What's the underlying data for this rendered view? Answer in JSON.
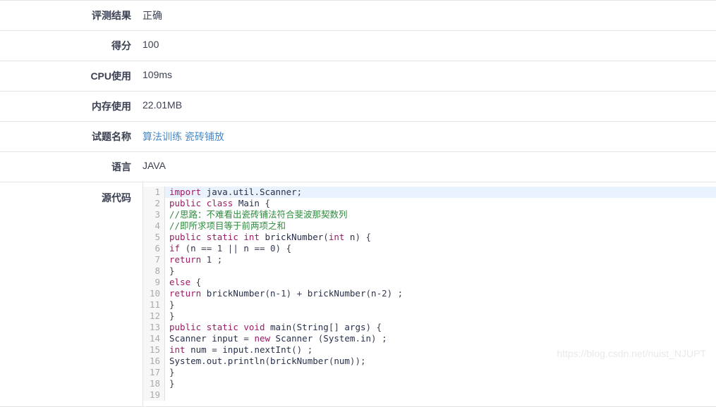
{
  "rows": [
    {
      "label": "评测结果",
      "value": "正确",
      "type": "text"
    },
    {
      "label": "得分",
      "value": "100",
      "type": "text"
    },
    {
      "label": "CPU使用",
      "value": "109ms",
      "type": "text"
    },
    {
      "label": "内存使用",
      "value": "22.01MB",
      "type": "text"
    },
    {
      "label": "试题名称",
      "value": "算法训练 瓷砖铺放",
      "type": "link",
      "link_parts": [
        "算法训练",
        "瓷砖铺放"
      ]
    },
    {
      "label": "语言",
      "value": "JAVA",
      "type": "text"
    },
    {
      "label": "源代码",
      "value": "",
      "type": "code"
    }
  ],
  "source_code": {
    "language": "JAVA",
    "highlighted_line": 1,
    "line_numbers": [
      "1",
      "2",
      "3",
      "4",
      "5",
      "6",
      "7",
      "8",
      "9",
      "10",
      "11",
      "12",
      "13",
      "14",
      "15",
      "16",
      "17",
      "18",
      "19"
    ],
    "lines": [
      "import java.util.Scanner;",
      "public class Main {",
      "//思路：不难看出瓷砖铺法符合斐波那契数列",
      "//即所求项目等于前两项之和",
      "public static int brickNumber(int n) {",
      "if (n == 1 || n == 0) {",
      "return 1 ;",
      "}",
      "else {",
      "return brickNumber(n-1) + brickNumber(n-2) ;",
      "}",
      "}",
      "public static void main(String[] args) {",
      "Scanner input = new Scanner (System.in) ;",
      "int num = input.nextInt() ;",
      "System.out.println(brickNumber(num));",
      "}",
      "}",
      ""
    ]
  },
  "watermark": {
    "text": "https://blog.csdn.net/nuist_NJUPT"
  },
  "colors": {
    "keyword": "#9b1b64",
    "comment": "#2e8b3e",
    "identifier": "#27304a",
    "link": "#4a89c8",
    "highlight_row": "#eaf2fd",
    "border": "#e4e4e4",
    "gutter_bg": "#f7f7f7"
  }
}
